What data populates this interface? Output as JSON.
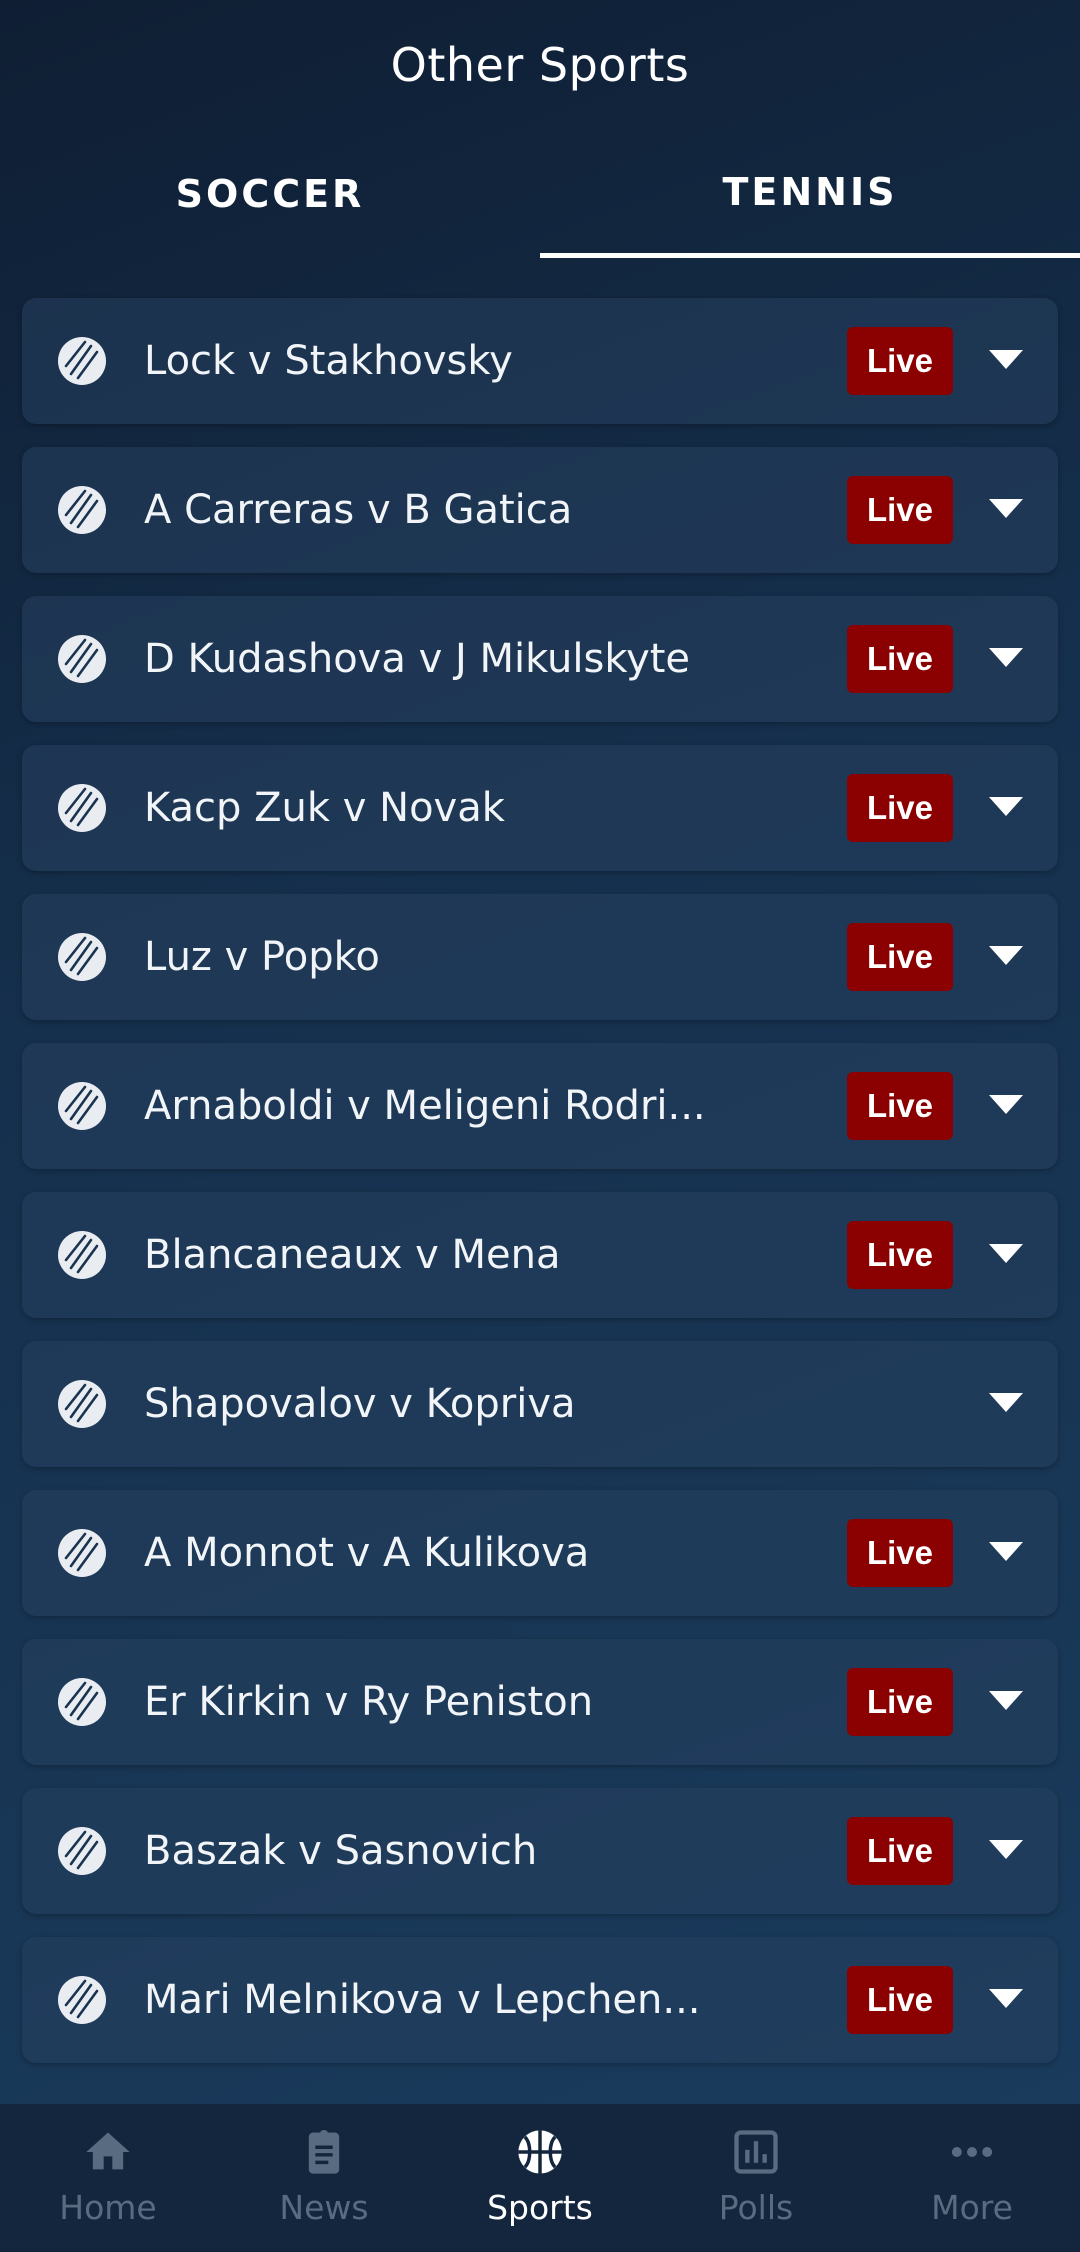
{
  "header": {
    "title": "Other Sports"
  },
  "tabs": [
    {
      "label": "SOCCER",
      "active": false
    },
    {
      "label": "TENNIS",
      "active": true
    }
  ],
  "matches": [
    {
      "name": "Lock v Stakhovsky",
      "live": "Live"
    },
    {
      "name": "A Carreras v B Gatica",
      "live": "Live"
    },
    {
      "name": "D Kudashova v J Mikulskyte",
      "live": "Live"
    },
    {
      "name": "Kacp Zuk v Novak",
      "live": "Live"
    },
    {
      "name": "Luz v Popko",
      "live": "Live"
    },
    {
      "name": "Arnaboldi v Meligeni Rodri...",
      "live": "Live"
    },
    {
      "name": "Blancaneaux v Mena",
      "live": "Live"
    },
    {
      "name": "Shapovalov v Kopriva",
      "live": ""
    },
    {
      "name": "A Monnot v A Kulikova",
      "live": "Live"
    },
    {
      "name": "Er Kirkin v Ry Peniston",
      "live": "Live"
    },
    {
      "name": "Baszak  v Sasnovich",
      "live": "Live"
    },
    {
      "name": "Mari Melnikova v Lepchen...",
      "live": "Live"
    }
  ],
  "nav": [
    {
      "label": "Home",
      "icon": "home-icon",
      "active": false
    },
    {
      "label": "News",
      "icon": "clipboard-icon",
      "active": false
    },
    {
      "label": "Sports",
      "icon": "basketball-icon",
      "active": true
    },
    {
      "label": "Polls",
      "icon": "poll-icon",
      "active": false
    },
    {
      "label": "More",
      "icon": "more-dots-icon",
      "active": false
    }
  ],
  "colors": {
    "live_bg": "#8b0000",
    "nav_bg": "#13263d",
    "nav_inactive": "#596b80"
  }
}
